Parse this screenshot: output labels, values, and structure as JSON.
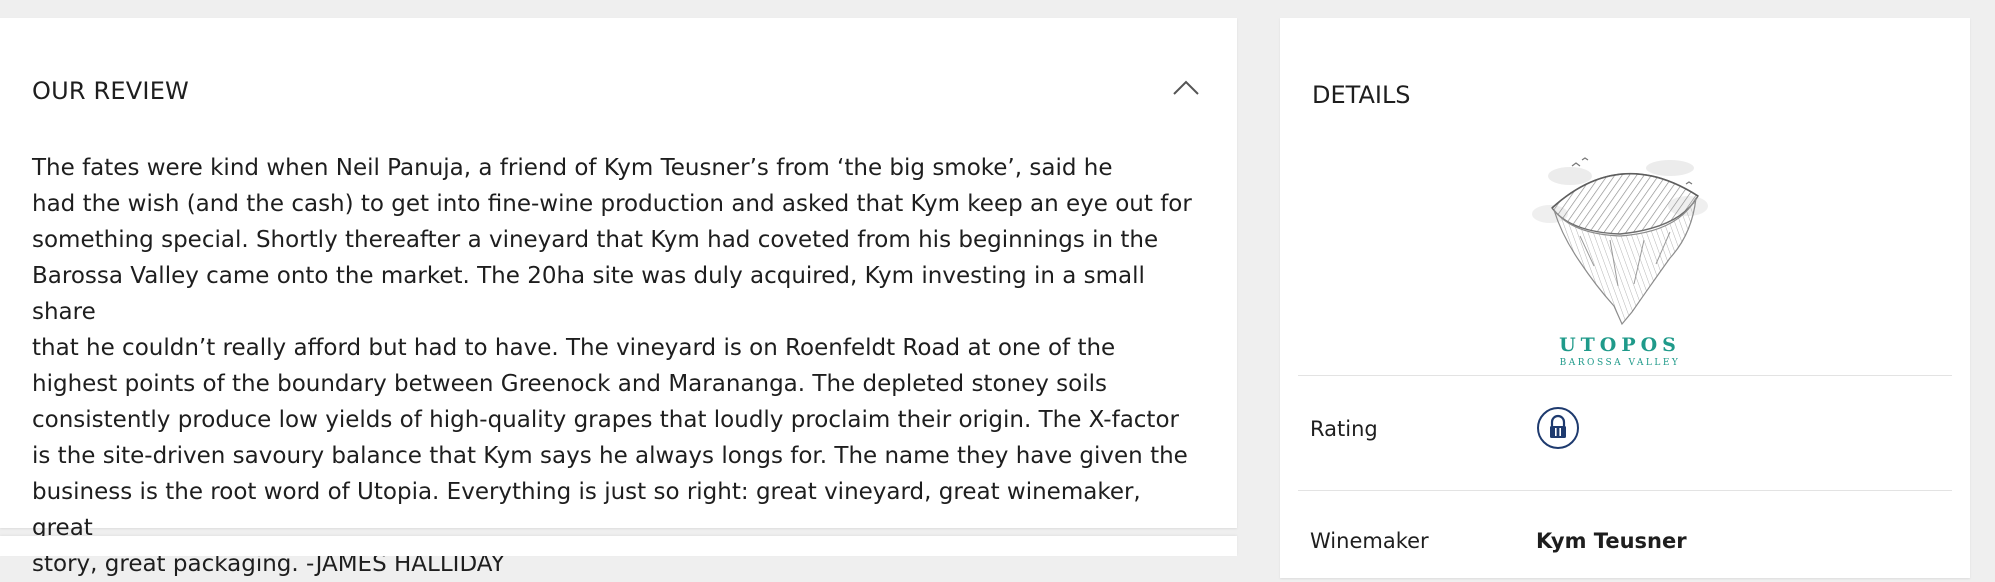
{
  "review": {
    "title": "OUR REVIEW",
    "collapse_icon": "chevron-up-icon",
    "body": "The fates were kind when Neil Panuja, a friend of Kym Teusner’s from ‘the big smoke’, said he\nhad the wish (and the cash) to get into fine-wine production and asked that Kym keep an eye out for\nsomething special. Shortly thereafter a vineyard that Kym had coveted from his beginnings in the\nBarossa Valley came onto the market. The 20ha site was duly acquired, Kym investing in a small share\nthat he couldn’t really afford but had to have. The vineyard is on Roenfeldt Road at one of the\nhighest points of the boundary between Greenock and Marananga. The depleted stoney soils\nconsistently produce low yields of high-quality grapes that loudly proclaim their origin. The X-factor\nis the site-driven savoury balance that Kym says he always longs for. The name they have given the\nbusiness is the root word of Utopia. Everything is just so right: great vineyard, great winemaker, great\nstory, great packaging. -JAMES HALLIDAY"
  },
  "details": {
    "title": "DETAILS",
    "logo": {
      "name": "UTOPOS",
      "subtitle": "BAROSSA VALLEY",
      "icon": "floating-island-logo",
      "color": "#1f9a8a"
    },
    "rows": [
      {
        "label": "Rating",
        "icon": "lock-icon",
        "color": "#1e3a6e"
      },
      {
        "label": "Winemaker",
        "value": "Kym Teusner"
      }
    ]
  }
}
